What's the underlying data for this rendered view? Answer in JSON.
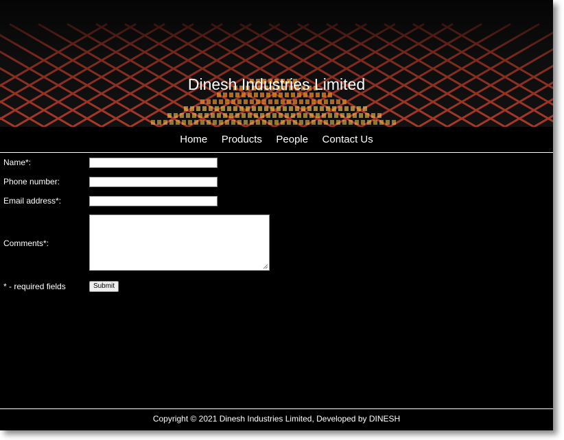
{
  "header": {
    "site_title": "Dinesh Industries Limited"
  },
  "nav": {
    "items": [
      {
        "label": "Home"
      },
      {
        "label": "Products"
      },
      {
        "label": "People"
      },
      {
        "label": "Contact Us"
      }
    ]
  },
  "form": {
    "name_label": "Name*:",
    "name_value": "",
    "phone_label": "Phone number:",
    "phone_value": "",
    "email_label": "Email address*:",
    "email_value": "",
    "comments_label": "Comments*:",
    "comments_value": "",
    "required_note": "* - required fields",
    "submit_label": "Submit"
  },
  "footer": {
    "copyright": "Copyright © 2021 Dinesh Industries Limited, Developed by DINESH"
  },
  "colors": {
    "page_background": "#000000",
    "text": "#ffffff",
    "banner_glow": "#ff6a1a",
    "banner_grid": "#c23a2a"
  }
}
